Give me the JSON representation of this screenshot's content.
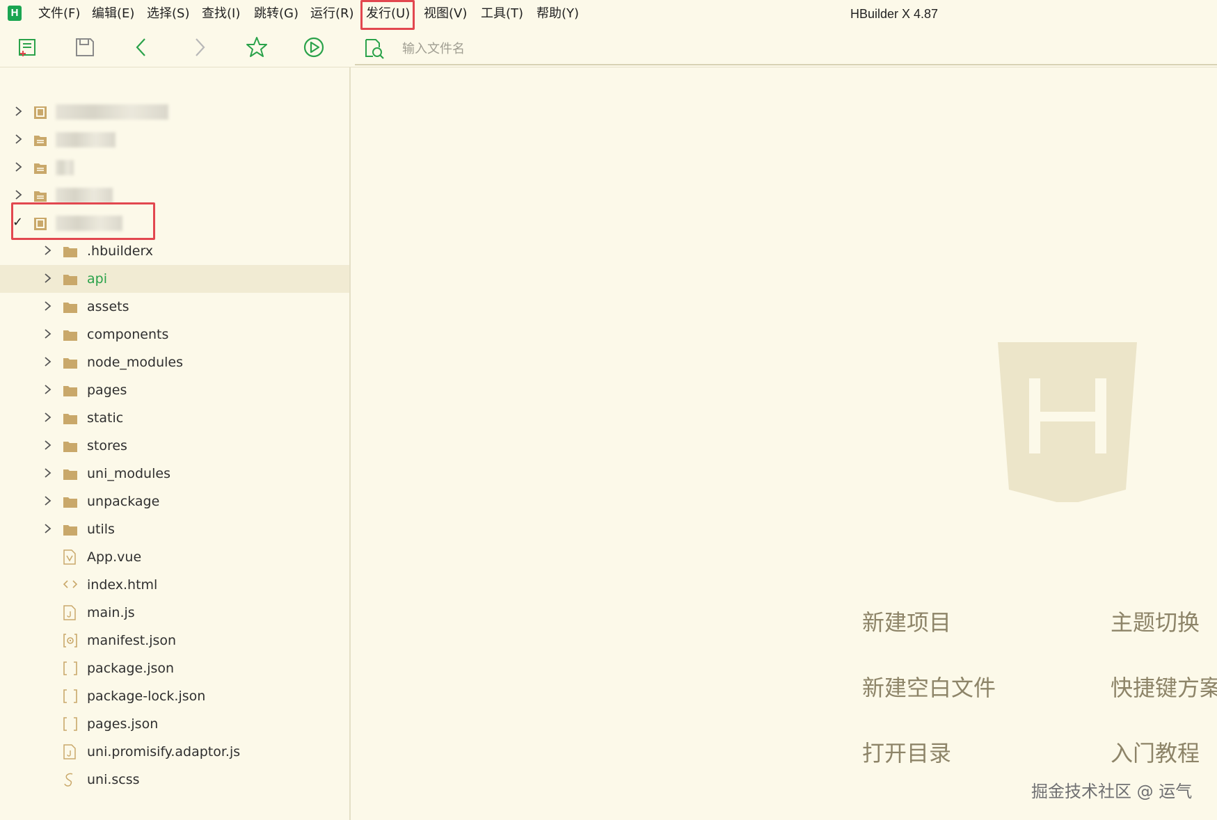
{
  "app": {
    "logo_letter": "H",
    "title": "HBuilder X 4.87"
  },
  "menu": [
    {
      "label": "文件(F)"
    },
    {
      "label": "编辑(E)"
    },
    {
      "label": "选择(S)"
    },
    {
      "label": "查找(I)"
    },
    {
      "label": "跳转(G)"
    },
    {
      "label": "运行(R)"
    },
    {
      "label": "发行(U)"
    },
    {
      "label": "视图(V)"
    },
    {
      "label": "工具(T)"
    },
    {
      "label": "帮助(Y)"
    }
  ],
  "toolbar": {
    "search_placeholder": "输入文件名",
    "icons": [
      "new-file-icon",
      "save-icon",
      "back-icon",
      "forward-icon",
      "favorite-star-icon",
      "run-icon",
      "file-search-icon"
    ]
  },
  "sidebar": {
    "projects": [
      {
        "type": "uni-project",
        "name": ""
      },
      {
        "type": "folder-project",
        "name": ""
      },
      {
        "type": "folder-project",
        "name": ""
      },
      {
        "type": "folder-project",
        "name": ""
      },
      {
        "type": "uni-project",
        "name": "",
        "expanded": true
      }
    ],
    "tree": [
      {
        "name": ".hbuilderx",
        "kind": "folder"
      },
      {
        "name": "api",
        "kind": "folder",
        "selected": true
      },
      {
        "name": "assets",
        "kind": "folder"
      },
      {
        "name": "components",
        "kind": "folder"
      },
      {
        "name": "node_modules",
        "kind": "folder"
      },
      {
        "name": "pages",
        "kind": "folder"
      },
      {
        "name": "static",
        "kind": "folder"
      },
      {
        "name": "stores",
        "kind": "folder"
      },
      {
        "name": "uni_modules",
        "kind": "folder"
      },
      {
        "name": "unpackage",
        "kind": "folder"
      },
      {
        "name": "utils",
        "kind": "folder"
      },
      {
        "name": "App.vue",
        "kind": "vue"
      },
      {
        "name": "index.html",
        "kind": "html"
      },
      {
        "name": "main.js",
        "kind": "js"
      },
      {
        "name": "manifest.json",
        "kind": "manifest"
      },
      {
        "name": "package.json",
        "kind": "json"
      },
      {
        "name": "package-lock.json",
        "kind": "json"
      },
      {
        "name": "pages.json",
        "kind": "json"
      },
      {
        "name": "uni.promisify.adaptor.js",
        "kind": "js"
      },
      {
        "name": "uni.scss",
        "kind": "scss"
      }
    ]
  },
  "welcome": {
    "actions": [
      {
        "label": "新建项目"
      },
      {
        "label": "主题切换"
      },
      {
        "label": "新建空白文件"
      },
      {
        "label": "快捷键方案"
      },
      {
        "label": "打开目录"
      },
      {
        "label": "入门教程"
      }
    ],
    "watermark": "掘金技术社区 @ 运气"
  },
  "colors": {
    "background": "#fcf9e9",
    "accent_green": "#1aa551",
    "highlight_red": "#e2474f",
    "folder": "#c9a86a",
    "selected_row": "#f1ebd3"
  }
}
